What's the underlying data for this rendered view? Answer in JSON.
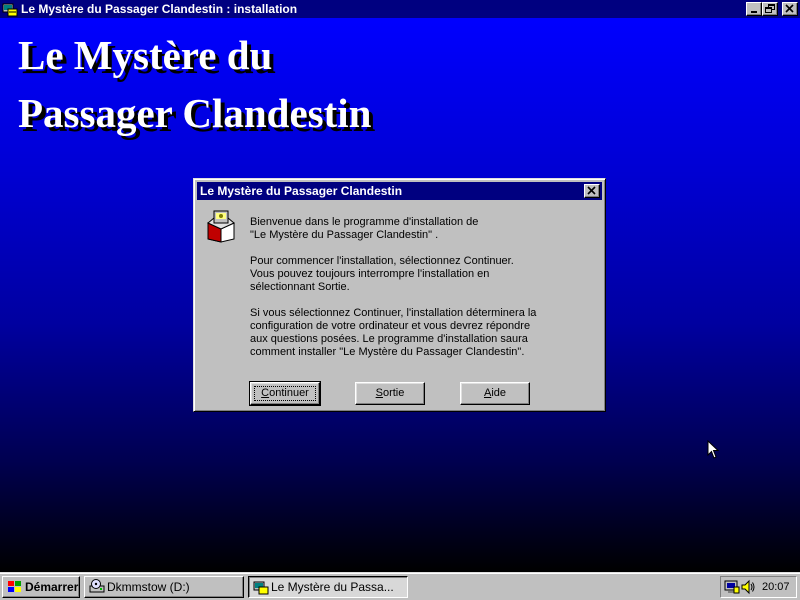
{
  "window": {
    "title": "Le Mystère du Passager Clandestin : installation",
    "icon": "setup-icon",
    "backdrop_title": "Le Mystère du\nPassager Clandestin"
  },
  "dialog": {
    "title": "Le Mystère du Passager Clandestin",
    "icon": "setup-box-icon",
    "paragraphs": [
      "Bienvenue dans  le programme d'installation de\n\"Le Mystère du Passager Clandestin\" .",
      "Pour commencer l'installation, sélectionnez Continuer.\nVous pouvez toujours interrompre l'installation en\nsélectionnant Sortie.",
      "Si vous sélectionnez Continuer, l'installation déterminera la\nconfiguration de votre ordinateur et vous devrez répondre\naux questions posées. Le programme d'installation saura\ncomment installer \"Le Mystère du Passager Clandestin\"."
    ],
    "buttons": {
      "continue": {
        "mnemonic": "C",
        "rest": "ontinuer"
      },
      "exit": {
        "mnemonic": "S",
        "rest": "ortie"
      },
      "help": {
        "mnemonic": "A",
        "rest": "ide"
      }
    }
  },
  "taskbar": {
    "start_label": "Démarrer",
    "tasks": [
      {
        "label": "Dkmmstow (D:)",
        "icon": "drive-icon"
      },
      {
        "label": "Le Mystère du Passa...",
        "icon": "setup-icon"
      }
    ],
    "clock": "20:07"
  },
  "colors": {
    "titlebar": "#000080",
    "face": "#c0c0c0",
    "backdrop_top": "#0000ff",
    "backdrop_bottom": "#000000"
  }
}
